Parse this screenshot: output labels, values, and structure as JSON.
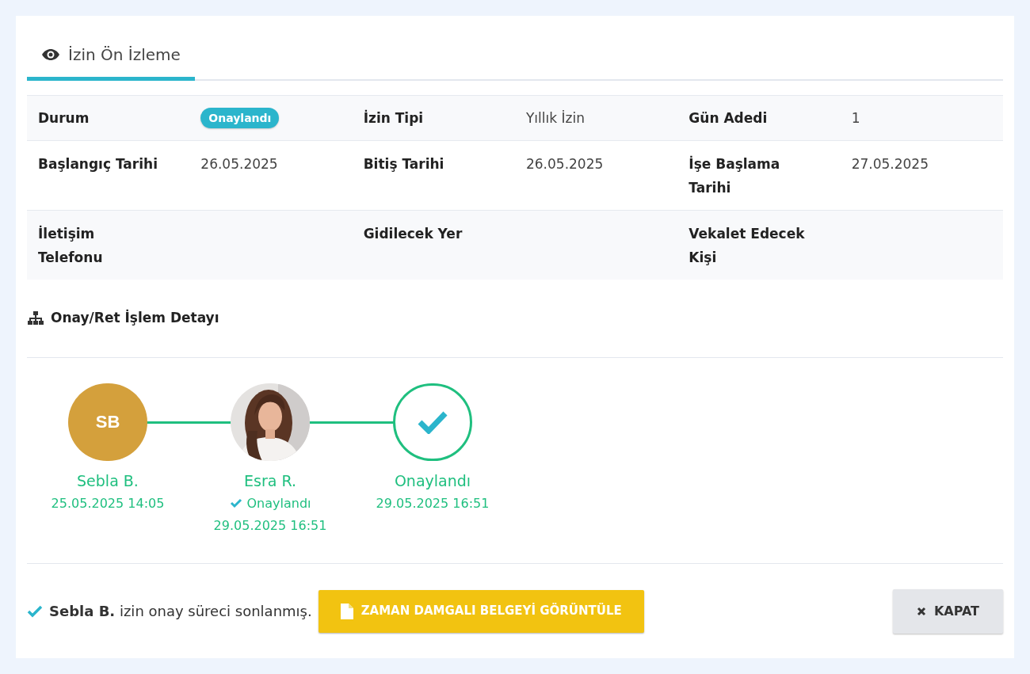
{
  "tabs": [
    {
      "label": "İzin Ön İzleme",
      "selected": true
    }
  ],
  "details": [
    [
      {
        "label": "Durum",
        "kind": "badge",
        "value": "Onaylandı"
      },
      {
        "label": "İzin Tipi",
        "kind": "text",
        "value": "Yıllık İzin"
      },
      {
        "label": "Gün Adedi",
        "kind": "text",
        "value": "1"
      }
    ],
    [
      {
        "label": "Başlangıç Tarihi",
        "kind": "text",
        "value": "26.05.2025"
      },
      {
        "label": "Bitiş Tarihi",
        "kind": "text",
        "value": "26.05.2025"
      },
      {
        "label": "İşe Başlama\nTarihi",
        "kind": "text",
        "value": "27.05.2025"
      }
    ],
    [
      {
        "label": "İletişim\nTelefonu",
        "kind": "empty"
      },
      {
        "label": "Gidilecek Yer",
        "kind": "empty"
      },
      {
        "label": "Vekalet Edecek\nKişi",
        "kind": "empty"
      }
    ]
  ],
  "section_title": "Onay/Ret İşlem Detayı",
  "steps": [
    {
      "kind": "initials",
      "initials": "SB",
      "name": "Sebla B.",
      "date": "25.05.2025 14:05"
    },
    {
      "name": "Esra R.",
      "status": "Onaylandı",
      "date": "29.05.2025 16:51"
    },
    {
      "kind": "done",
      "name": "Onaylandı",
      "date": "29.05.2025 16:51"
    }
  ],
  "footer": {
    "message": "**Sebla B.** izin onay süreci sonlanmış.",
    "document_button": "ZAMAN DAMGALI BELGEYİ GÖRÜNTÜLE",
    "close_button": "KAPAT"
  }
}
